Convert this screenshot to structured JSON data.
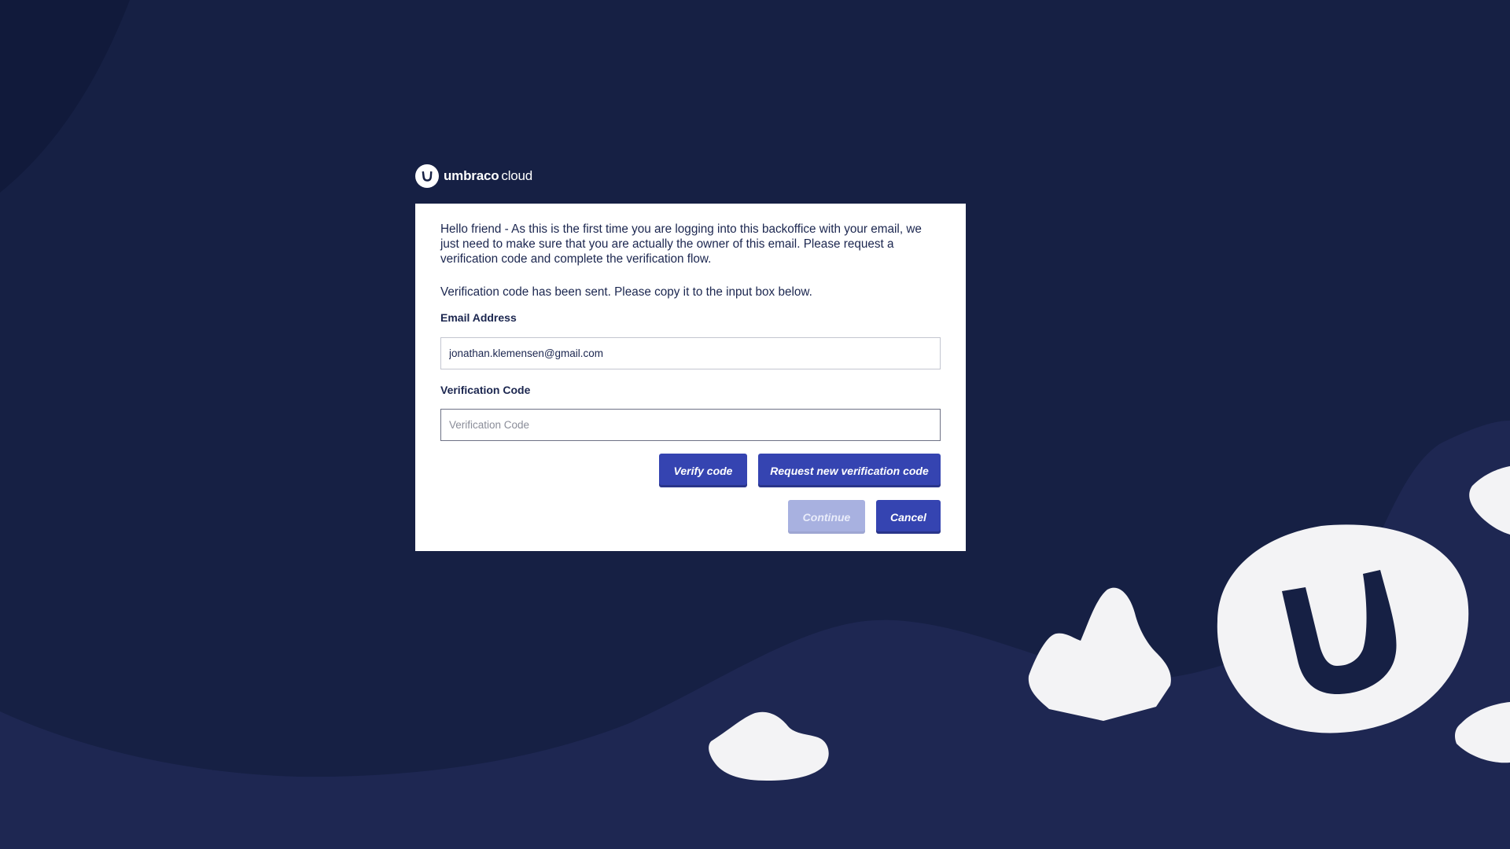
{
  "brand": {
    "name_strong": "umbraco",
    "name_light": "cloud"
  },
  "card": {
    "intro_text": "Hello friend - As this is the first time you are logging into this backoffice with your email, we just need to make sure that you are actually the owner of this email. Please request a verification code and complete the verification flow.",
    "sent_message": "Verification code has been sent. Please copy it to the input box below."
  },
  "form": {
    "email_label": "Email Address",
    "email_value": "jonathan.klemensen@gmail.com",
    "code_label": "Verification Code",
    "code_placeholder": "Verification Code",
    "code_value": ""
  },
  "buttons": {
    "verify_label": "Verify code",
    "request_label": "Request new verification code",
    "continue_label": "Continue",
    "cancel_label": "Cancel"
  },
  "state": {
    "continue_disabled": true
  },
  "colors": {
    "background": "#162044",
    "background_hill": "#1e2752",
    "primary_button": "#3544b1",
    "disabled_button": "#a8b1e0",
    "shape_fill": "#f3f3f5"
  },
  "icons": {
    "logo": "umbraco-logo-icon",
    "decorations": [
      "rock-icon",
      "umbraco-u-rock-icon"
    ]
  }
}
